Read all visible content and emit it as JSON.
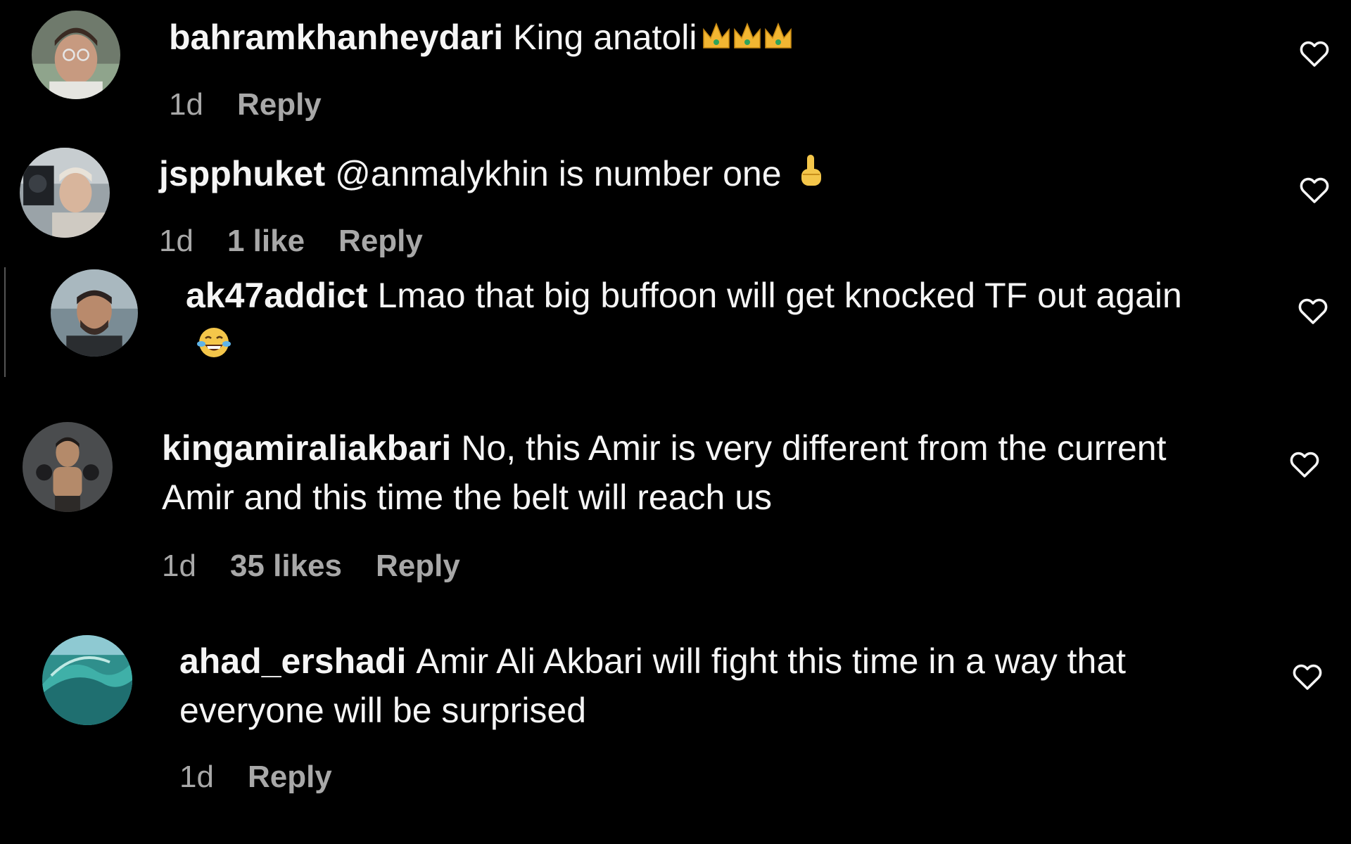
{
  "colors": {
    "background": "#000000",
    "text": "#f5f5f5",
    "secondary": "#a8a8a8"
  },
  "comments": [
    {
      "username": "bahramkhanheydari",
      "text": "King anatoli",
      "emoji": "crown-emoji x3",
      "time": "1d",
      "reply": "Reply"
    },
    {
      "username": "jspphuket",
      "text": "@anmalykhin is number one",
      "emoji": "index-pointing-up-emoji",
      "time": "1d",
      "likes": "1 like",
      "reply": "Reply"
    },
    {
      "username": "ak47addict",
      "text": "Lmao that big buffoon will get knocked TF out again",
      "emoji": "tears-of-joy-emoji"
    },
    {
      "username": "kingamiraliakbari",
      "text": "No, this Amir is very different from the current Amir and this time the belt will reach us",
      "time": "1d",
      "likes": "35 likes",
      "reply": "Reply"
    },
    {
      "username": "ahad_ershadi",
      "text": "Amir Ali Akbari will fight this time in a way that everyone will be surprised",
      "time": "1d",
      "reply": "Reply"
    }
  ]
}
